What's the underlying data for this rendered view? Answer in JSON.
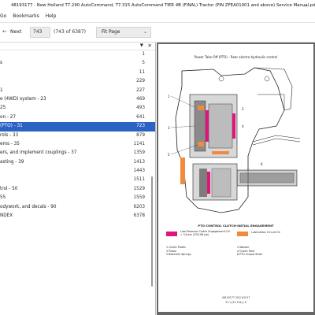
{
  "window": {
    "title": "48193177 - New Holland T7.290 AutoCommand, T7.315 AutoCommand TIER 4B (FINAL) Tractor (PIN ZFEA01001 and above) Service Manual.pdf",
    "minimize_glyph": "—"
  },
  "menu": [
    "Go",
    "Bookmarks",
    "Help"
  ],
  "toolbar": {
    "prev_glyph": "←",
    "next_label": "Next",
    "page_value": "743",
    "page_count": "(743 of 6387)",
    "zoom": "Fit Page",
    "icons": [
      "arrow-left-icon",
      "chevron-down-icon"
    ]
  },
  "sidebar": {
    "bookmarks": [
      {
        "label": "",
        "page": "1"
      },
      {
        "label": "s",
        "page": "5"
      },
      {
        "label": "",
        "page": "11"
      },
      {
        "label": "",
        "page": "229"
      },
      {
        "label": "1",
        "page": "227"
      },
      {
        "label": "e (4WD) system - 23",
        "page": "469"
      },
      {
        "label": "25",
        "page": "493"
      },
      {
        "label": "on - 27",
        "page": "641"
      },
      {
        "label": "(PTO) - 31",
        "page": "723",
        "selected": true
      },
      {
        "label": "rols - 33",
        "page": "879"
      },
      {
        "label": "ems - 35",
        "page": "1141"
      },
      {
        "label": "ers, and implement couplings - 37",
        "page": "1359"
      },
      {
        "label": "asting - 39",
        "page": "1413"
      },
      {
        "label": "",
        "page": "1443"
      },
      {
        "label": "",
        "page": "1511"
      },
      {
        "label": "trol - 50",
        "page": "1529"
      },
      {
        "label": "55",
        "page": "1559"
      },
      {
        "label": "odywork, and decals - 90",
        "page": "6203"
      },
      {
        "label": "NDEX",
        "page": "6378"
      }
    ]
  },
  "page": {
    "title": "Power Take-Off (PTO) - Rear electro-hydraulic control",
    "caption": "PTO CONTROL CLUTCH-INITIAL ENGAGEMENT",
    "legend": [
      {
        "color": "#e0157a",
        "text": "Low-Pressure Clutch Engagement Oil = 14 bar (203.06 psi)"
      },
      {
        "color": "#f08a3c",
        "text": "Lubrication Circuit Oil"
      }
    ],
    "parts_left": [
      "1 Clutch Plates",
      "3 Piston",
      "5 Belleville Springs"
    ],
    "parts_right": [
      "2 Washer",
      "4 Clutch Pack",
      "6 PTO Output Shaft"
    ],
    "footer_code": "48193177 30/11/2017",
    "footer_page": "31.1 [31.104] / 6"
  }
}
